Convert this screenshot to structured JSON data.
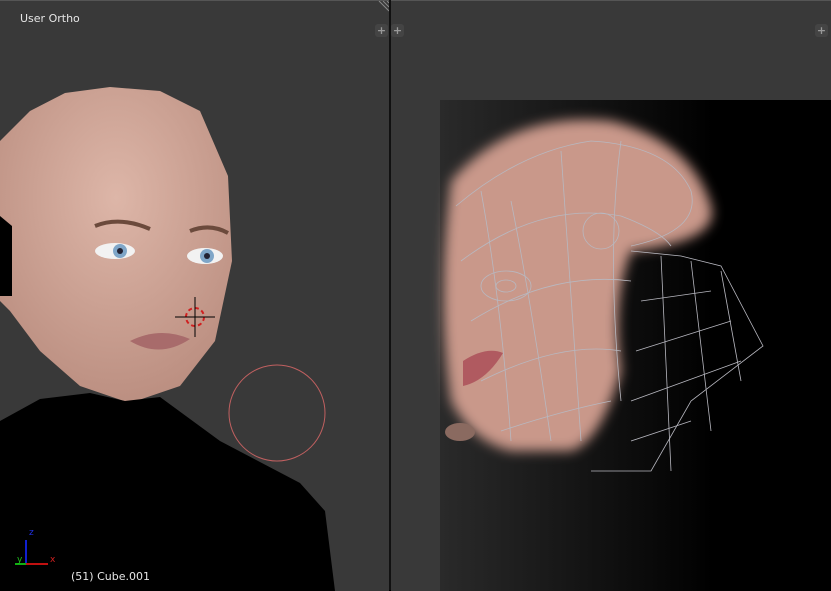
{
  "left_viewport": {
    "title": "User Ortho",
    "object_info": "(51) Cube.001",
    "axes": {
      "x": "x",
      "y": "y",
      "z": "z"
    }
  },
  "right_viewport": {},
  "colors": {
    "viewport_bg": "#393939",
    "skin": "#d6ad9e",
    "uv_wire": "#b8b8c0",
    "x_axis": "#c01010",
    "y_axis": "#10b010",
    "z_axis": "#1020d0"
  }
}
